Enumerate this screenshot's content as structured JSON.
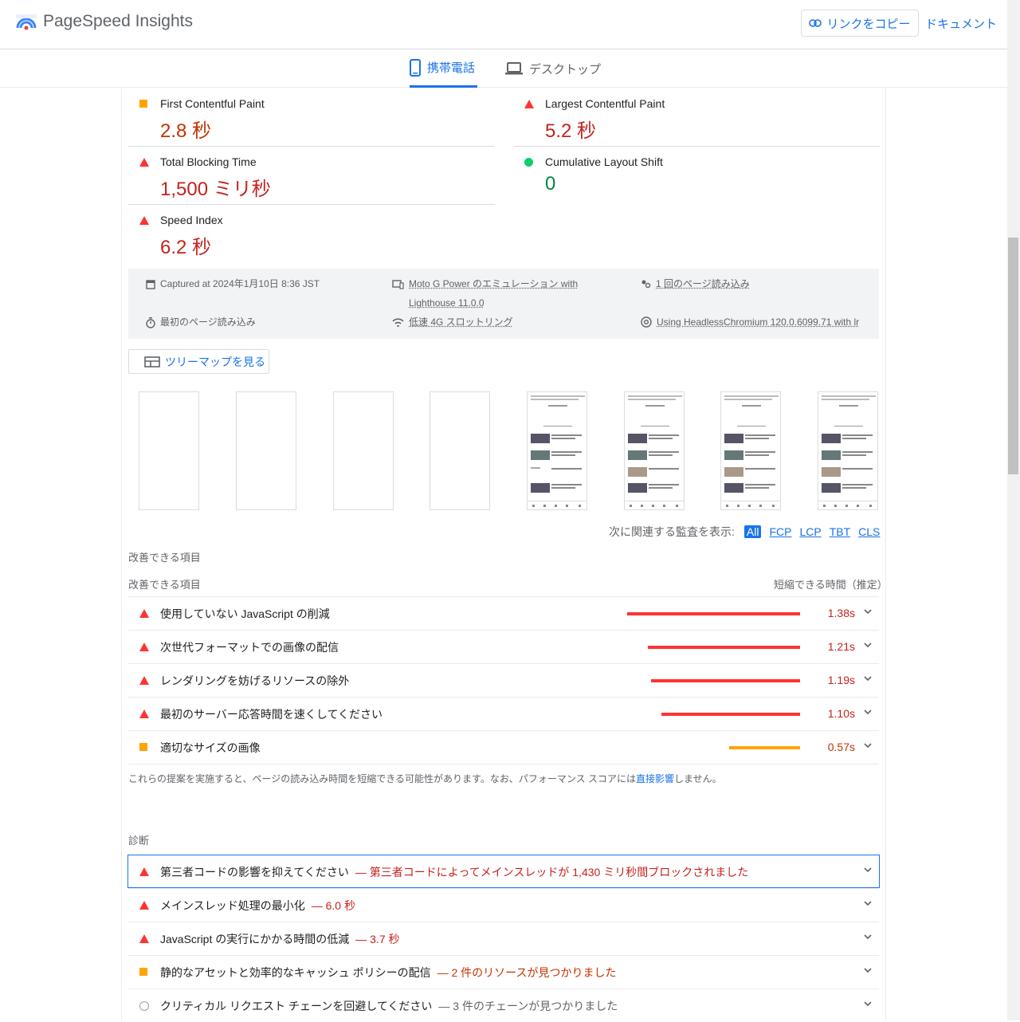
{
  "header": {
    "app_name": "PageSpeed Insights",
    "copy_link": "リンクをコピー",
    "docs": "ドキュメント"
  },
  "tabs": [
    {
      "label": "携帯電話",
      "active": true
    },
    {
      "label": "デスクトップ",
      "active": false
    }
  ],
  "metrics": [
    {
      "label": "First Contentful Paint",
      "value": "2.8 秒",
      "status": "average"
    },
    {
      "label": "Largest Contentful Paint",
      "value": "5.2 秒",
      "status": "fail"
    },
    {
      "label": "Total Blocking Time",
      "value": "1,500 ミリ秒",
      "status": "fail"
    },
    {
      "label": "Cumulative Layout Shift",
      "value": "0",
      "status": "pass"
    },
    {
      "label": "Speed Index",
      "value": "6.2 秒",
      "status": "fail"
    }
  ],
  "info": {
    "captured": "Captured at 2024年1月10日 8:36 JST",
    "device_1": "Moto G Power のエミュレーション with",
    "device_2": "Lighthouse 11.0.0",
    "loads": "1 回のページ読み込み",
    "initial_load": "最初のページ読み込み",
    "throttling": "低速 4G スロットリング",
    "browser": "Using HeadlessChromium 120.0.6099.71 with lr"
  },
  "treemap_button": "ツリーマップを見る",
  "filter": {
    "label": "次に関連する監査を表示:",
    "options": [
      "All",
      "FCP",
      "LCP",
      "TBT",
      "CLS"
    ]
  },
  "opportunities": {
    "section_title": "改善できる項目",
    "column_left": "改善できる項目",
    "column_right": "短縮できる時間（推定）",
    "items": [
      {
        "title": "使用していない JavaScript の削減",
        "savings": "1.38s",
        "status": "fail",
        "bar_fraction": 1.0
      },
      {
        "title": "次世代フォーマットでの画像の配信",
        "savings": "1.21s",
        "status": "fail",
        "bar_fraction": 0.88
      },
      {
        "title": "レンダリングを妨げるリソースの除外",
        "savings": "1.19s",
        "status": "fail",
        "bar_fraction": 0.86
      },
      {
        "title": "最初のサーバー応答時間を速くしてください",
        "savings": "1.10s",
        "status": "fail",
        "bar_fraction": 0.8
      },
      {
        "title": "適切なサイズの画像",
        "savings": "0.57s",
        "status": "average",
        "bar_fraction": 0.41
      }
    ],
    "note_before": "これらの提案を実施すると、ページの読み込み時間を短縮できる可能性があります。なお、パフォーマンス スコアには",
    "note_link": "直接影響",
    "note_after": "しません。"
  },
  "diagnostics": {
    "section_title": "診断",
    "items": [
      {
        "title": "第三者コードの影響を抑えてください",
        "detail": "— 第三者コードによってメインスレッドが 1,430 ミリ秒間ブロックされました",
        "status": "fail"
      },
      {
        "title": "メインスレッド処理の最小化",
        "detail": "— 6.0 秒",
        "status": "fail"
      },
      {
        "title": "JavaScript の実行にかかる時間の低減",
        "detail": "— 3.7 秒",
        "status": "fail"
      },
      {
        "title": "静的なアセットと効率的なキャッシュ ポリシーの配信",
        "detail": "— 2 件のリソースが見つかりました",
        "status": "average"
      },
      {
        "title": "クリティカル リクエスト チェーンを回避してください",
        "detail": "— 3 件のチェーンが見つかりました",
        "status": "info"
      }
    ]
  },
  "colors": {
    "accent": "#1a73e8",
    "fail": "#ff3333",
    "average": "#ffa400",
    "pass": "#0cce6b"
  }
}
